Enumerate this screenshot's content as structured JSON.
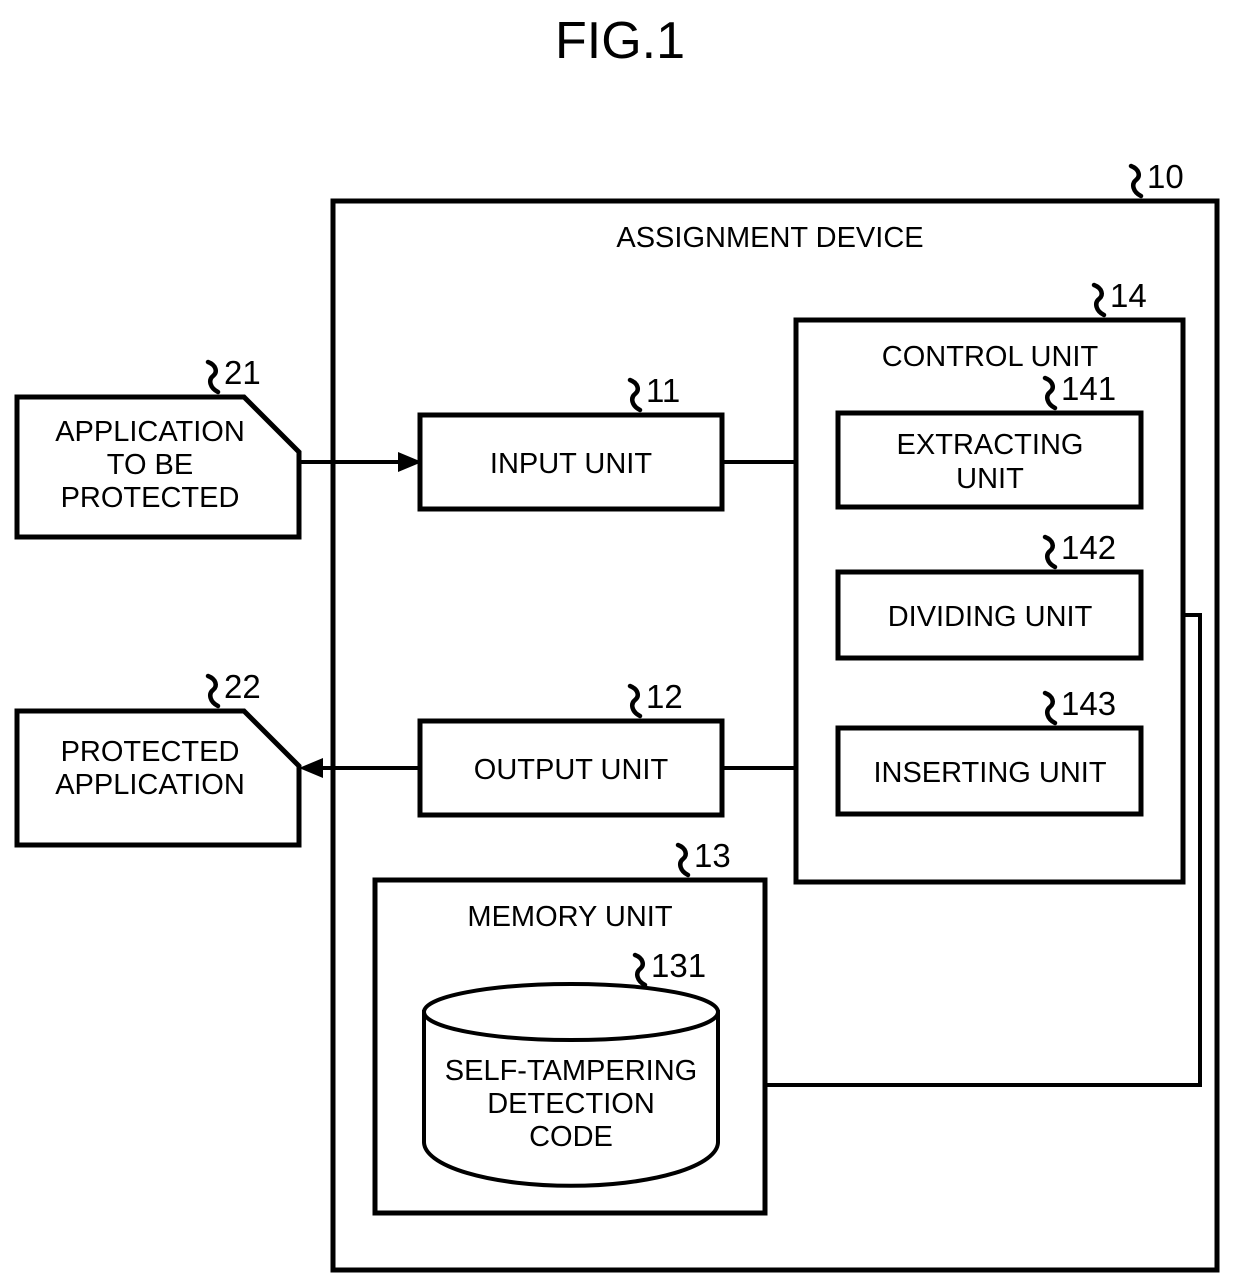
{
  "figure": {
    "title": "FIG.1"
  },
  "outer": {
    "label": "ASSIGNMENT DEVICE",
    "ref": "10"
  },
  "external_docs": [
    {
      "name": "application-to-be-protected",
      "lines": [
        "APPLICATION",
        "TO BE",
        "PROTECTED"
      ],
      "ref": "21"
    },
    {
      "name": "protected-application",
      "lines": [
        "PROTECTED",
        "APPLICATION"
      ],
      "ref": "22"
    }
  ],
  "io_units": [
    {
      "name": "input-unit",
      "label": "INPUT UNIT",
      "ref": "11"
    },
    {
      "name": "output-unit",
      "label": "OUTPUT UNIT",
      "ref": "12"
    }
  ],
  "control_unit": {
    "label": "CONTROL UNIT",
    "ref": "14",
    "children": [
      {
        "name": "extracting-unit",
        "lines": [
          "EXTRACTING",
          "UNIT"
        ],
        "ref": "141"
      },
      {
        "name": "dividing-unit",
        "lines": [
          "DIVIDING UNIT"
        ],
        "ref": "142"
      },
      {
        "name": "inserting-unit",
        "lines": [
          "INSERTING UNIT"
        ],
        "ref": "143"
      }
    ]
  },
  "memory_unit": {
    "label": "MEMORY UNIT",
    "ref": "13",
    "store": {
      "name": "self-tampering-detection-code",
      "lines": [
        "SELF-TAMPERING",
        "DETECTION",
        "CODE"
      ],
      "ref": "131"
    }
  },
  "colors": {
    "stroke": "#000000",
    "fill": "#ffffff"
  }
}
